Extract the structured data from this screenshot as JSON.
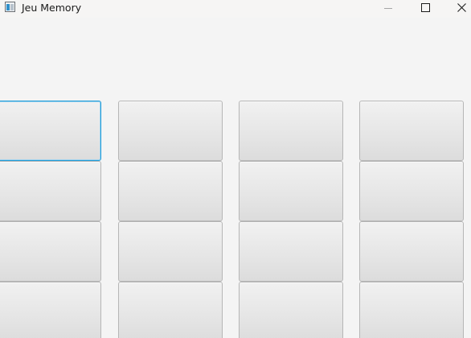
{
  "window": {
    "title": "Jeu Memory",
    "app_icon": "java-app-icon",
    "controls": {
      "minimize": "minimize-icon",
      "maximize": "maximize-icon",
      "close": "close-icon"
    },
    "colors": {
      "background": "#f4f4f4",
      "card_face_top": "#f1f1f1",
      "card_face_bottom": "#dcdcdc",
      "card_border": "#b6b6b6",
      "focus_border": "#1e9bd7"
    }
  },
  "board": {
    "columns": 4,
    "rows": 4,
    "cards": [
      {
        "row": 1,
        "col": 1,
        "face": "hidden",
        "focused": true
      },
      {
        "row": 1,
        "col": 2,
        "face": "hidden"
      },
      {
        "row": 1,
        "col": 3,
        "face": "hidden"
      },
      {
        "row": 1,
        "col": 4,
        "face": "hidden"
      },
      {
        "row": 2,
        "col": 1,
        "face": "hidden"
      },
      {
        "row": 2,
        "col": 2,
        "face": "hidden"
      },
      {
        "row": 2,
        "col": 3,
        "face": "hidden"
      },
      {
        "row": 2,
        "col": 4,
        "face": "hidden"
      },
      {
        "row": 3,
        "col": 1,
        "face": "hidden"
      },
      {
        "row": 3,
        "col": 2,
        "face": "hidden"
      },
      {
        "row": 3,
        "col": 3,
        "face": "hidden"
      },
      {
        "row": 3,
        "col": 4,
        "face": "hidden"
      },
      {
        "row": 4,
        "col": 1,
        "face": "hidden"
      },
      {
        "row": 4,
        "col": 2,
        "face": "hidden"
      },
      {
        "row": 4,
        "col": 3,
        "face": "hidden"
      },
      {
        "row": 4,
        "col": 4,
        "face": "hidden"
      }
    ]
  }
}
